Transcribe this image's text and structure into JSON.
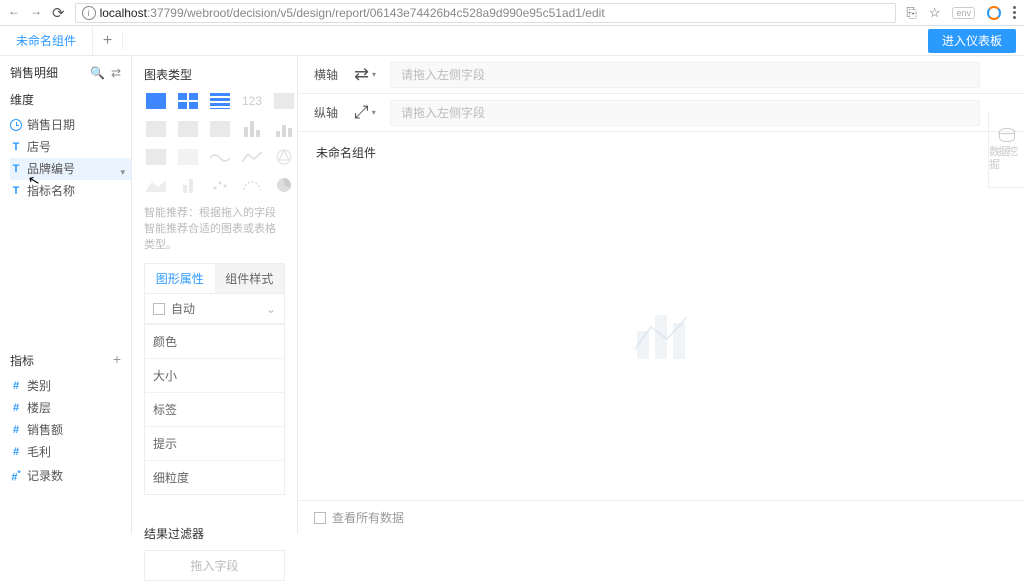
{
  "browser": {
    "url_prefix": "localhost",
    "url_rest": ":37799/webroot/decision/v5/design/report/06143e74426b4c528a9d990e95c51ad1/edit",
    "ext_text": "env"
  },
  "top": {
    "tab_label": "未命名组件",
    "enter_label": "进入仪表板"
  },
  "left": {
    "dataset_title": "销售明细",
    "dim_title": "维度",
    "dims": [
      "销售日期",
      "店号",
      "品牌编号",
      "指标名称"
    ],
    "measure_title": "指标",
    "measures": [
      "类别",
      "楼层",
      "销售额",
      "毛利",
      "记录数"
    ]
  },
  "mid": {
    "chart_type_label": "图表类型",
    "num_sample": "123",
    "hint": "智能推荐：根据拖入的字段智能推荐合适的图表或表格类型。",
    "tab_shape": "图形属性",
    "tab_style": "组件样式",
    "auto_label": "自动",
    "props": [
      "颜色",
      "大小",
      "标签",
      "提示",
      "细粒度"
    ],
    "filter_label": "结果过滤器",
    "filter_placeholder": "拖入字段"
  },
  "main": {
    "h_axis": "横轴",
    "v_axis": "纵轴",
    "axis_placeholder": "请拖入左侧字段",
    "mining": "数据挖掘",
    "canvas_title": "未命名组件",
    "bottom_check": "查看所有数据"
  }
}
